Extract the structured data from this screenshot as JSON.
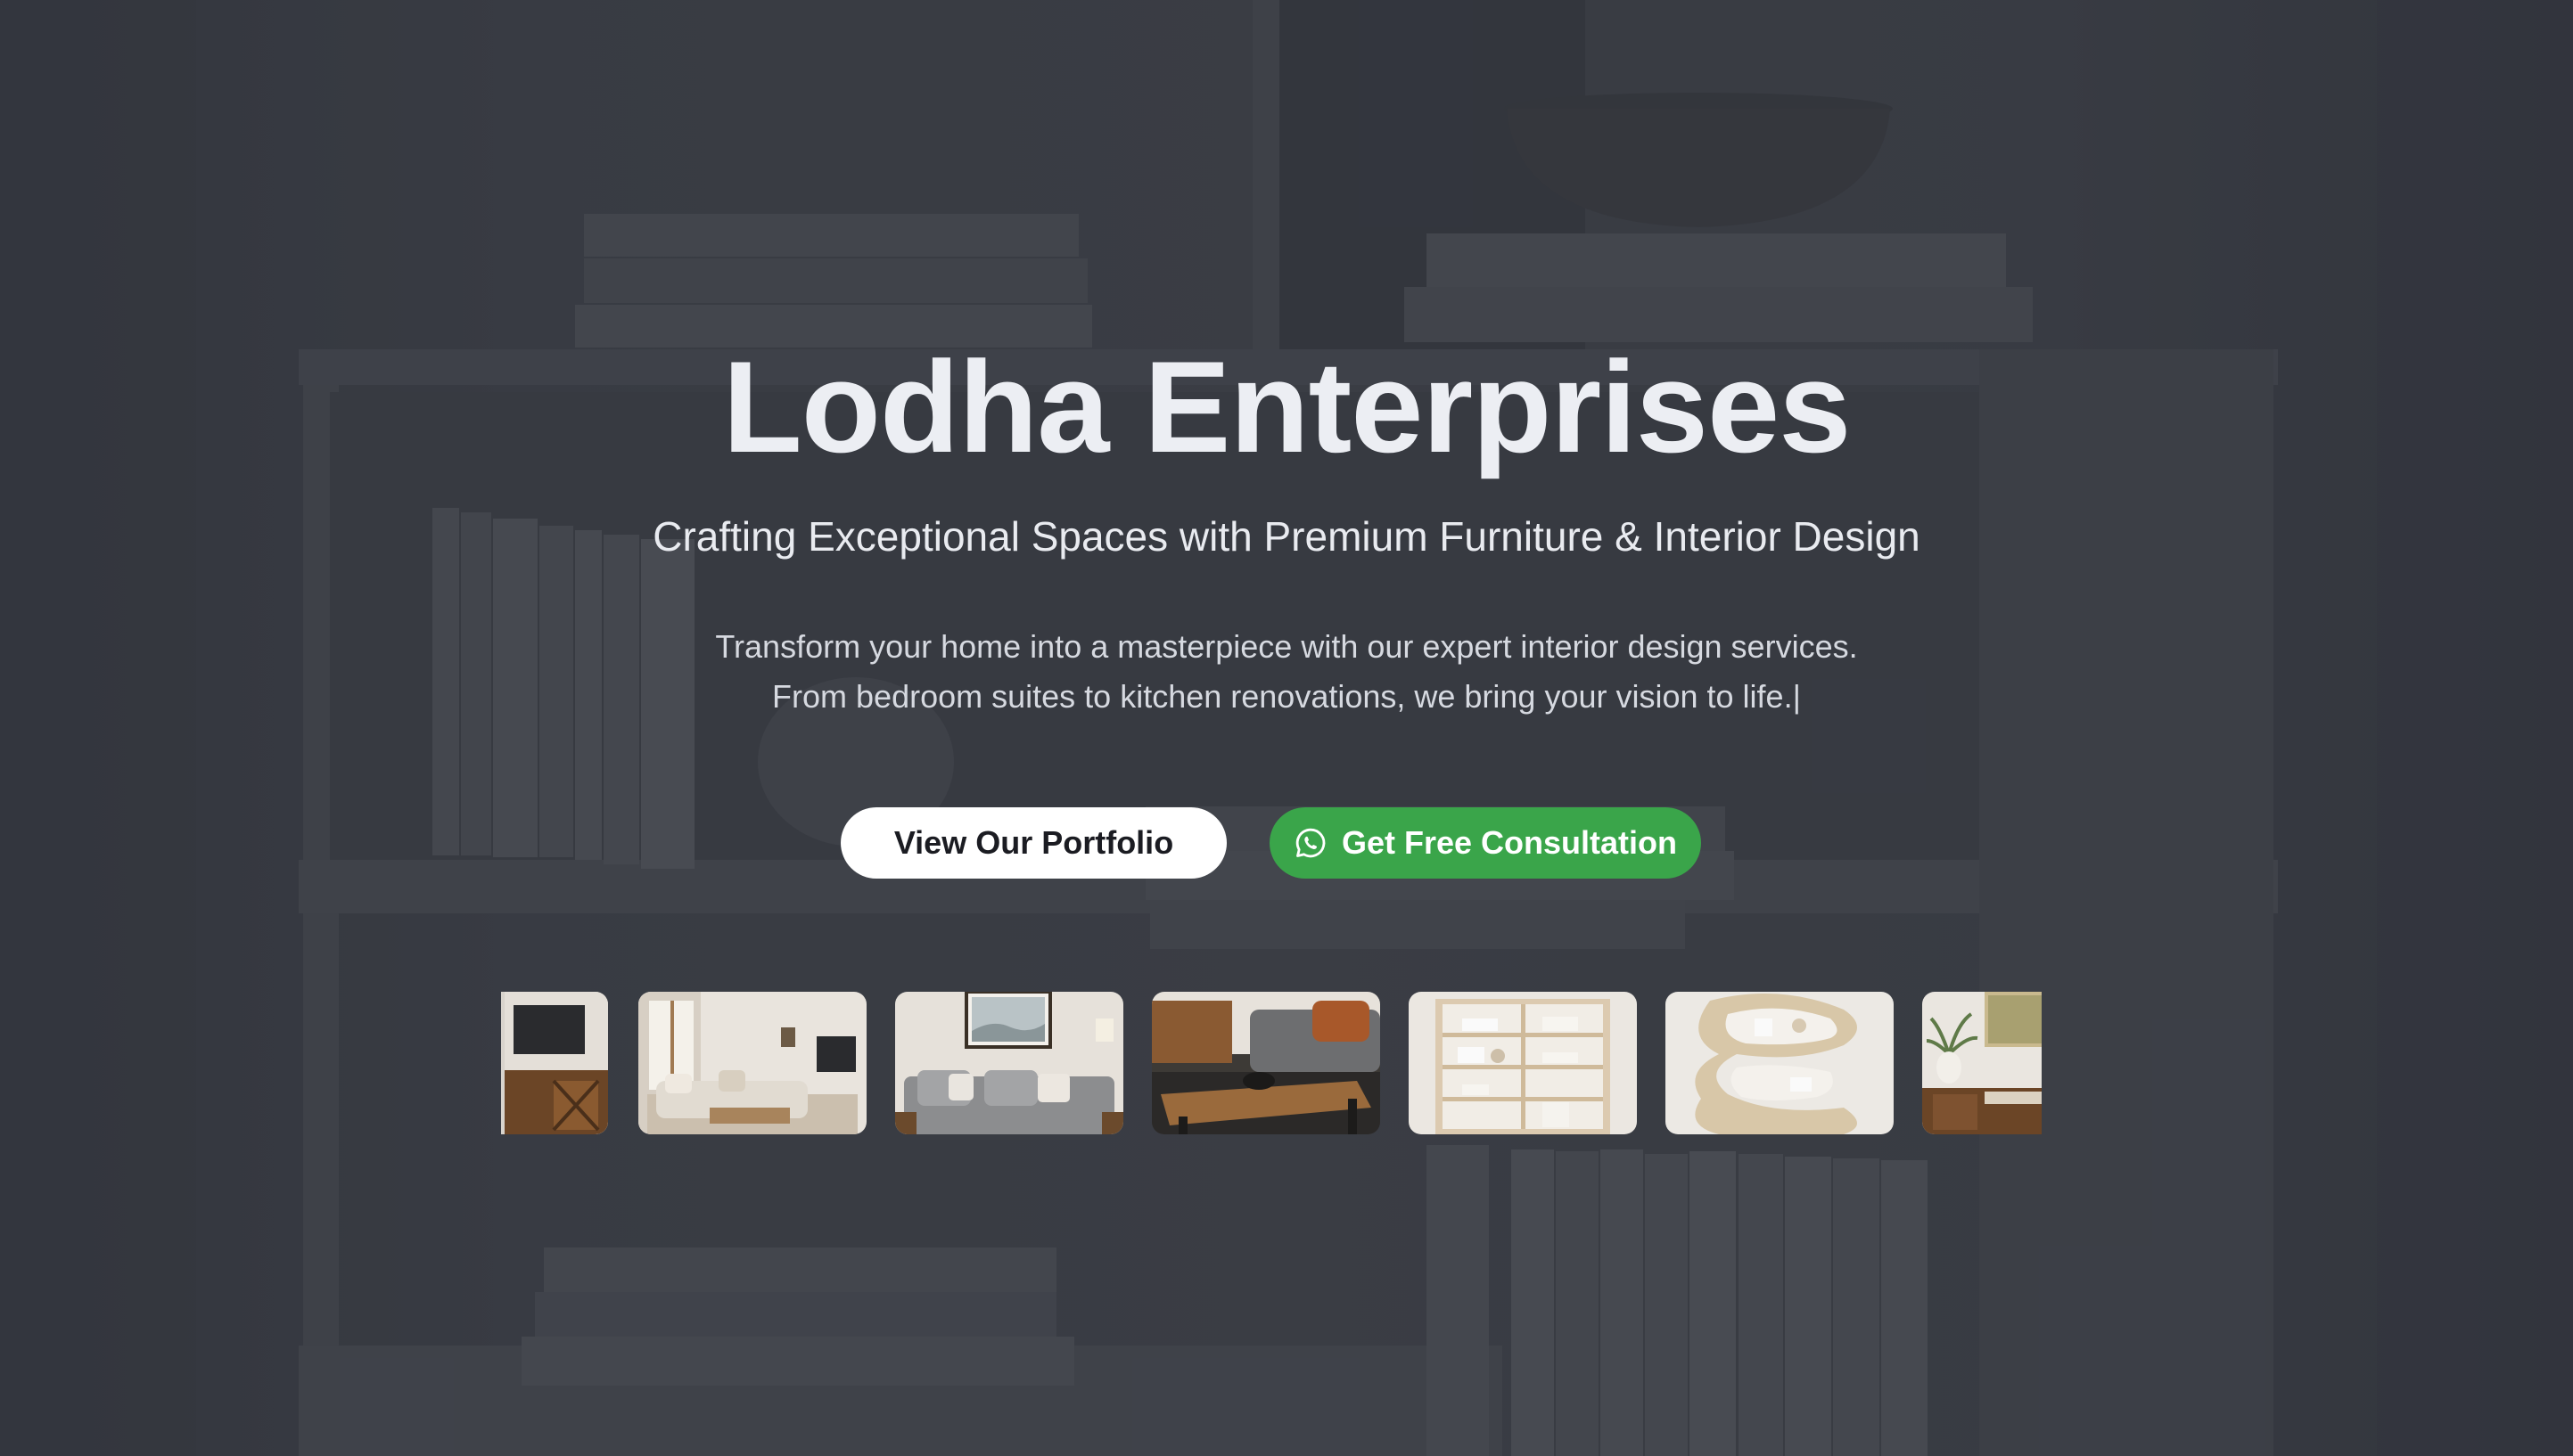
{
  "hero": {
    "title": "Lodha Enterprises",
    "subtitle": "Crafting Exceptional Spaces with Premium Furniture & Interior Design",
    "description_line1": "Transform your home into a masterpiece with our expert interior design services.",
    "description_line2": "From bedroom suites to kitchen renovations, we bring your vision to life.",
    "typing_caret": "|"
  },
  "buttons": {
    "portfolio_label": "View Our Portfolio",
    "consultation_label": "Get Free Consultation",
    "consultation_icon": "whatsapp-icon"
  },
  "gallery": {
    "items": [
      "tv-cabinet-thumbnail",
      "living-room-thumbnail",
      "grey-sofa-thumbnail",
      "coffee-table-thumbnail",
      "bookshelf-thumbnail",
      "wave-shelf-thumbnail",
      "side-table-plant-thumbnail"
    ]
  },
  "colors": {
    "accent_green": "#3aa54a",
    "background": "#3b3e47",
    "title_text": "#eceef3"
  }
}
